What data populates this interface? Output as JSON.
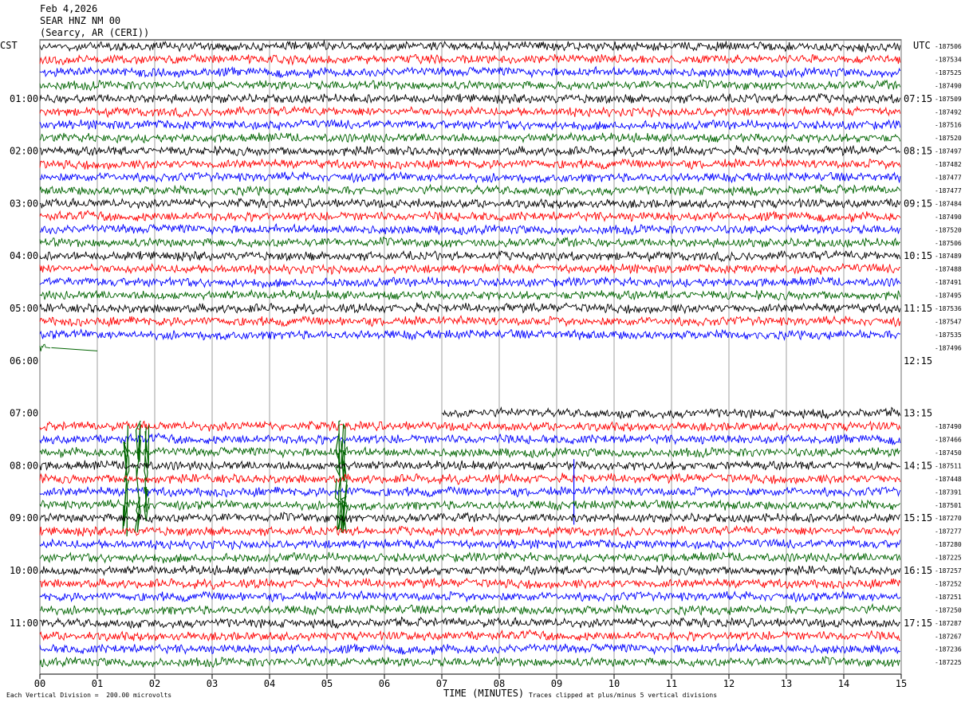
{
  "header": {
    "date": "Feb 4,2026",
    "station": "SEAR HNZ NM 00",
    "location": "(Searcy, AR (CERI))"
  },
  "left_tz": "CST",
  "right_tz": "UTC",
  "footer": {
    "scale": "Each Vertical Division =  200.00 microvolts",
    "x_title": "TIME (MINUTES)",
    "clip_note": "Traces clipped at plus/minus 5 vertical divisions"
  },
  "chart_data": {
    "type": "line",
    "title": "",
    "xlabel": "TIME (MINUTES)",
    "ylabel": "",
    "x_ticks": [
      "00",
      "01",
      "02",
      "03",
      "04",
      "05",
      "06",
      "07",
      "08",
      "09",
      "10",
      "11",
      "12",
      "13",
      "14",
      "15"
    ],
    "xlim": [
      0,
      15
    ],
    "grid": "vertical lines each minute",
    "trace_colors": [
      "#000000",
      "#ff0000",
      "#0000ff",
      "#006400"
    ],
    "left_hour_labels": [
      "01:00",
      "02:00",
      "03:00",
      "04:00",
      "05:00",
      "06:00",
      "07:00",
      "08:00",
      "09:00",
      "10:00",
      "11:00"
    ],
    "right_hour_labels": [
      "07:15",
      "08:15",
      "09:15",
      "10:15",
      "11:15",
      "12:15",
      "13:15",
      "14:15",
      "15:15",
      "16:15",
      "17:15"
    ],
    "rows": [
      {
        "offset": "-187506",
        "status": "full"
      },
      {
        "offset": "-187534",
        "status": "full"
      },
      {
        "offset": "-187525",
        "status": "full"
      },
      {
        "offset": "-187490",
        "status": "full"
      },
      {
        "offset": "-187509",
        "status": "full"
      },
      {
        "offset": "-187492",
        "status": "full"
      },
      {
        "offset": "-187516",
        "status": "full"
      },
      {
        "offset": "-187520",
        "status": "full"
      },
      {
        "offset": "-187497",
        "status": "full"
      },
      {
        "offset": "-187482",
        "status": "full"
      },
      {
        "offset": "-187477",
        "status": "full"
      },
      {
        "offset": "-187477",
        "status": "full"
      },
      {
        "offset": "-187484",
        "status": "full"
      },
      {
        "offset": "-187490",
        "status": "full"
      },
      {
        "offset": "-187520",
        "status": "full"
      },
      {
        "offset": "-187506",
        "status": "full"
      },
      {
        "offset": "-187489",
        "status": "full"
      },
      {
        "offset": "-187488",
        "status": "full"
      },
      {
        "offset": "-187491",
        "status": "full"
      },
      {
        "offset": "-187495",
        "status": "full"
      },
      {
        "offset": "-187536",
        "status": "full"
      },
      {
        "offset": "-187547",
        "status": "full"
      },
      {
        "offset": "-187535",
        "status": "full"
      },
      {
        "offset": "-187496",
        "status": "gap_start",
        "data_until_min": 0.2
      },
      {
        "offset": "",
        "status": "empty"
      },
      {
        "offset": "",
        "status": "empty"
      },
      {
        "offset": "",
        "status": "empty"
      },
      {
        "offset": "",
        "status": "empty"
      },
      {
        "offset": "",
        "status": "resume",
        "data_from_min": 7.0
      },
      {
        "offset": "-187490",
        "status": "full"
      },
      {
        "offset": "-187466",
        "status": "full"
      },
      {
        "offset": "-187450",
        "status": "full",
        "bursts": [
          1.5,
          1.7,
          1.85,
          5.2,
          5.3
        ]
      },
      {
        "offset": "-187511",
        "status": "full"
      },
      {
        "offset": "-187448",
        "status": "full"
      },
      {
        "offset": "-187391",
        "status": "full",
        "spike_min": 9.3
      },
      {
        "offset": "-187501",
        "status": "full",
        "bursts": [
          1.5,
          1.7,
          1.85,
          5.2,
          5.3
        ]
      },
      {
        "offset": "-187270",
        "status": "full"
      },
      {
        "offset": "-187277",
        "status": "full"
      },
      {
        "offset": "-187280",
        "status": "full"
      },
      {
        "offset": "-187225",
        "status": "full"
      },
      {
        "offset": "-187257",
        "status": "full"
      },
      {
        "offset": "-187252",
        "status": "full"
      },
      {
        "offset": "-187251",
        "status": "full"
      },
      {
        "offset": "-187250",
        "status": "full"
      },
      {
        "offset": "-187287",
        "status": "full"
      },
      {
        "offset": "-187267",
        "status": "full"
      },
      {
        "offset": "-187236",
        "status": "full"
      },
      {
        "offset": "-187225",
        "status": "full"
      }
    ]
  }
}
